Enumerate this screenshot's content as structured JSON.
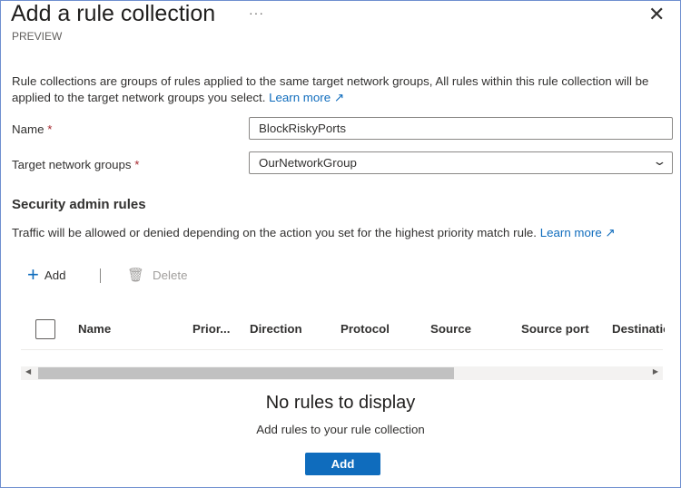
{
  "header": {
    "title": "Add a rule collection",
    "more": "···",
    "close": "✕",
    "subtitle": "PREVIEW"
  },
  "intro": {
    "line1": "Rule collections are groups of rules applied to the same target network groups, All rules within this rule collection will be",
    "line2": "applied to the target network groups you select.",
    "learn_more": "Learn more"
  },
  "form": {
    "name_label": "Name",
    "name_value": "BlockRiskyPorts",
    "target_label": "Target network groups",
    "target_value": "OurNetworkGroup",
    "required": "*"
  },
  "rules": {
    "heading": "Security admin rules",
    "description": "Traffic will be allowed or denied depending on the action you set for the highest priority match rule.",
    "learn_more": "Learn more"
  },
  "toolbar": {
    "add": "Add",
    "delete": "Delete"
  },
  "table": {
    "columns": [
      "Name",
      "Prior...",
      "Direction",
      "Protocol",
      "Source",
      "Source port",
      "Destinatio"
    ]
  },
  "empty": {
    "title": "No rules to display",
    "subtitle": "Add rules to your rule collection",
    "button": "Add"
  }
}
